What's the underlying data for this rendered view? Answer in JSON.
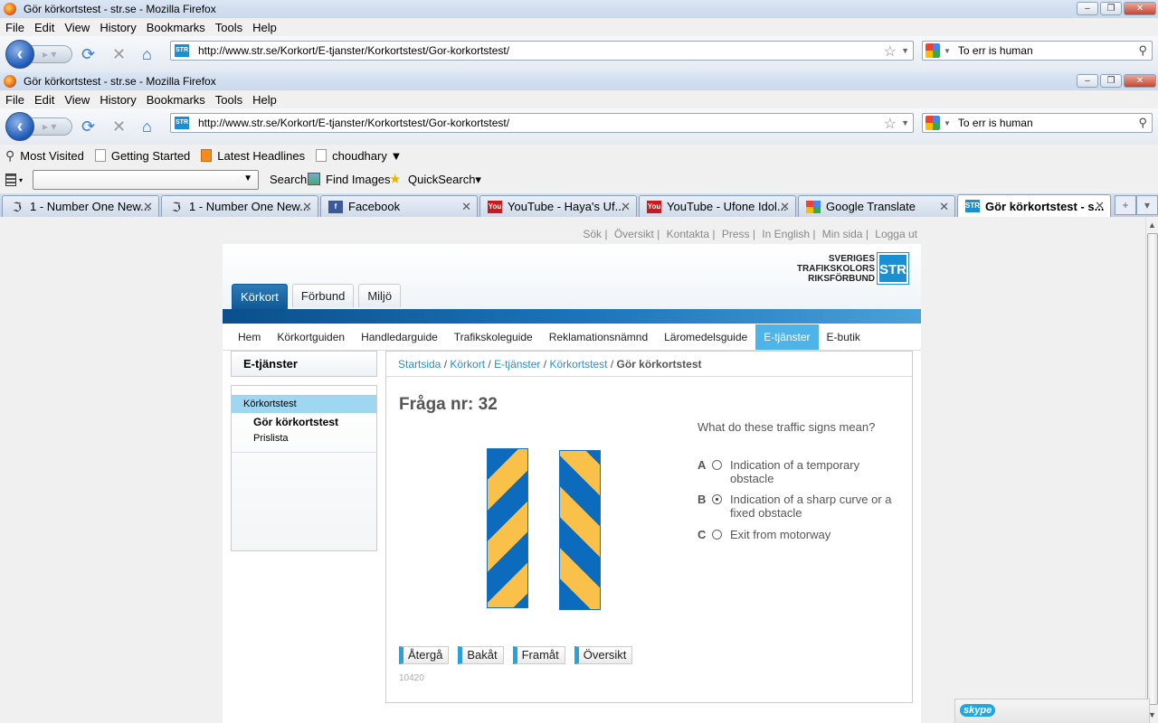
{
  "window1": {
    "title": "Gör körkortstest - str.se - Mozilla Firefox",
    "menu": [
      "File",
      "Edit",
      "View",
      "History",
      "Bookmarks",
      "Tools",
      "Help"
    ],
    "url": "http://www.str.se/Korkort/E-tjanster/Korkortstest/Gor-korkortstest/",
    "search": "To err is human"
  },
  "window2": {
    "title": "Gör körkortstest - str.se - Mozilla Firefox",
    "menu": [
      "File",
      "Edit",
      "View",
      "History",
      "Bookmarks",
      "Tools",
      "Help"
    ],
    "url": "http://www.str.se/Korkort/E-tjanster/Korkortstest/Gor-korkortstest/",
    "search": "To err is human"
  },
  "bookmarks": [
    "Most Visited",
    "Getting Started",
    "Latest Headlines",
    "choudhary ▼"
  ],
  "toolbar2": {
    "search": "Search",
    "find_images": "Find Images",
    "quicksearch": "QuickSearch▾"
  },
  "tabs": [
    {
      "label": "1 - Number One New..."
    },
    {
      "label": "1 - Number One New..."
    },
    {
      "label": "Facebook"
    },
    {
      "label": "YouTube - Haya's Uf..."
    },
    {
      "label": "YouTube - Ufone Idol..."
    },
    {
      "label": "Google Translate"
    },
    {
      "label": "Gör körkortstest - s..."
    }
  ],
  "site": {
    "toplinks": [
      "Sök",
      "Översikt",
      "Kontakta",
      "Press",
      "In English",
      "Min sida",
      "Logga ut"
    ],
    "logo": {
      "line1": "SVERIGES",
      "line2": "TRAFIKSKOLORS",
      "line3": "RIKSFÖRBUND",
      "mark": "STR"
    },
    "main_tabs": [
      "Körkort",
      "Förbund",
      "Miljö"
    ],
    "subnav": [
      "Hem",
      "Körkortguiden",
      "Handledarguide",
      "Trafikskoleguide",
      "Reklamationsnämnd",
      "Läromedelsguide",
      "E-tjänster",
      "E-butik"
    ],
    "sidebar": {
      "title": "E-tjänster",
      "item": "Körkortstest",
      "sub1": "Gör körkortstest",
      "sub2": "Prislista"
    },
    "breadcrumb": {
      "c1": "Startsida",
      "c2": "Körkort",
      "c3": "E-tjänster",
      "c4": "Körkortstest",
      "current": "Gör körkortstest"
    },
    "question_title": "Fråga nr: 32",
    "question": "What do these traffic signs mean?",
    "options": [
      {
        "letter": "A",
        "text": "Indication of a temporary obstacle",
        "selected": false
      },
      {
        "letter": "B",
        "text": "Indication of a sharp curve or a fixed obstacle",
        "selected": true
      },
      {
        "letter": "C",
        "text": "Exit from motorway",
        "selected": false
      }
    ],
    "buttons": [
      "Återgå",
      "Bakåt",
      "Framåt",
      "Översikt"
    ],
    "code": "10420"
  },
  "skype": "skype",
  "colors": {
    "sign_blue": "#0d6bbd",
    "sign_yellow": "#f9c04a",
    "accent": "#4eb3e6"
  }
}
